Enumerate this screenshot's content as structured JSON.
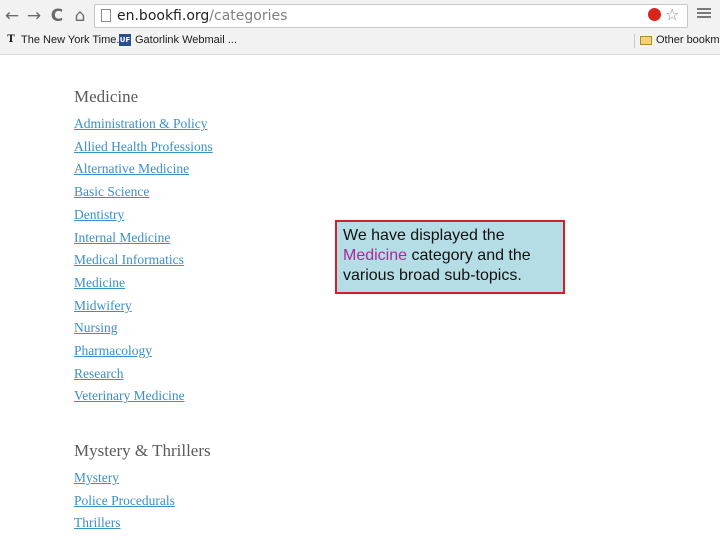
{
  "browser": {
    "url_host": "en.bookfi.org",
    "url_path": "/categories",
    "back_glyph": "←",
    "forward_glyph": "→",
    "reload_glyph": "C",
    "home_glyph": "⌂",
    "star_glyph": "☆"
  },
  "bookmarks": {
    "items": [
      {
        "label": "The New York Time...",
        "favicon": "T"
      },
      {
        "label": "Gatorlink Webmail ...",
        "favicon": "UF"
      }
    ],
    "other_label": "Other bookmar"
  },
  "categories": [
    {
      "heading": "Medicine",
      "links": [
        "Administration & Policy",
        "Allied Health Professions",
        "Alternative Medicine",
        "Basic Science",
        "Dentistry",
        "Internal Medicine",
        "Medical Informatics",
        "Medicine",
        "Midwifery",
        "Nursing",
        "Pharmacology",
        "Research",
        "Veterinary Medicine"
      ]
    },
    {
      "heading": "Mystery & Thrillers",
      "links": [
        "Mystery",
        "Police Procedurals",
        "Thrillers"
      ]
    }
  ],
  "annotation": {
    "line1": "We have displayed the",
    "highlight": "Medicine",
    "line2_rest": " category and the",
    "line3": "various broad sub-topics.",
    "highlight_color": "#b0259c",
    "border_color": "#d0202a",
    "background": "#b5dde5"
  },
  "colors": {
    "link": "#3a8fc6",
    "heading": "#5a5a5a"
  }
}
